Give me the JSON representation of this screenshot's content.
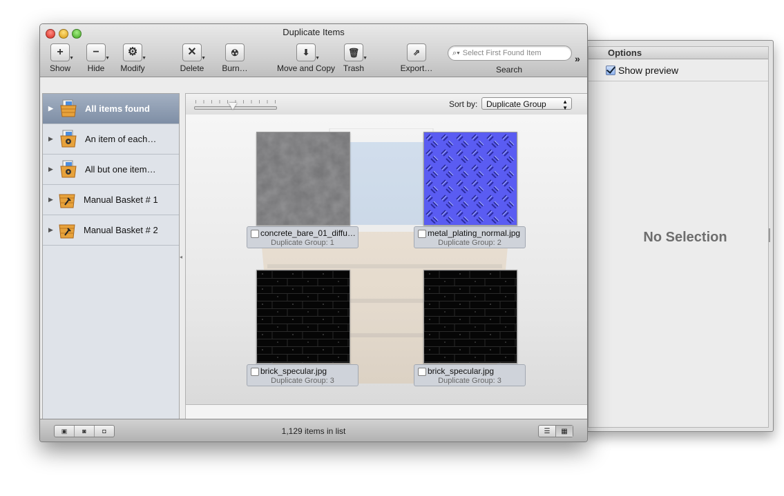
{
  "window": {
    "title": "Duplicate Items"
  },
  "toolbar": {
    "show": {
      "label": "Show",
      "icon": "plus-icon"
    },
    "hide": {
      "label": "Hide",
      "icon": "minus-icon"
    },
    "modify": {
      "label": "Modify",
      "icon": "gear-icon"
    },
    "delete": {
      "label": "Delete",
      "icon": "x-icon"
    },
    "burn": {
      "label": "Burn…",
      "icon": "burn-radiation-icon"
    },
    "move_copy": {
      "label": "Move and Copy",
      "icon": "folder-arrow-icon"
    },
    "trash": {
      "label": "Trash",
      "icon": "trash-icon"
    },
    "export": {
      "label": "Export…",
      "icon": "export-document-icon"
    },
    "search": {
      "placeholder": "Select First Found Item",
      "label": "Search"
    },
    "overflow": "»"
  },
  "sidebar": {
    "items": [
      {
        "label": "All items found",
        "selected": true,
        "icon": "basket-icon"
      },
      {
        "label": "An item of each…",
        "selected": false,
        "icon": "basket-gear-icon"
      },
      {
        "label": "All but one item…",
        "selected": false,
        "icon": "basket-gear-icon"
      },
      {
        "label": "Manual Basket # 1",
        "selected": false,
        "icon": "basket-wrench-icon"
      },
      {
        "label": "Manual Basket # 2",
        "selected": false,
        "icon": "basket-wrench-icon"
      }
    ]
  },
  "content": {
    "sort_label": "Sort by:",
    "sort_value": "Duplicate Group",
    "items": [
      {
        "name": "concrete_bare_01_diffu…",
        "group": "Duplicate Group: 1"
      },
      {
        "name": "metal_plating_normal.jpg",
        "group": "Duplicate Group: 2"
      },
      {
        "name": "brick_specular.jpg",
        "group": "Duplicate Group: 3"
      },
      {
        "name": "brick_specular.jpg",
        "group": "Duplicate Group: 3"
      }
    ]
  },
  "status": {
    "count_text": "1,129 items in list"
  },
  "drawer": {
    "header": "Options",
    "show_preview_label": "Show preview",
    "show_preview_checked": true,
    "no_selection": "No Selection"
  },
  "colors": {
    "selection": "#8796ad",
    "sidebar_bg": "#dfe3e9",
    "metal_normal": "#5a5cf2"
  }
}
